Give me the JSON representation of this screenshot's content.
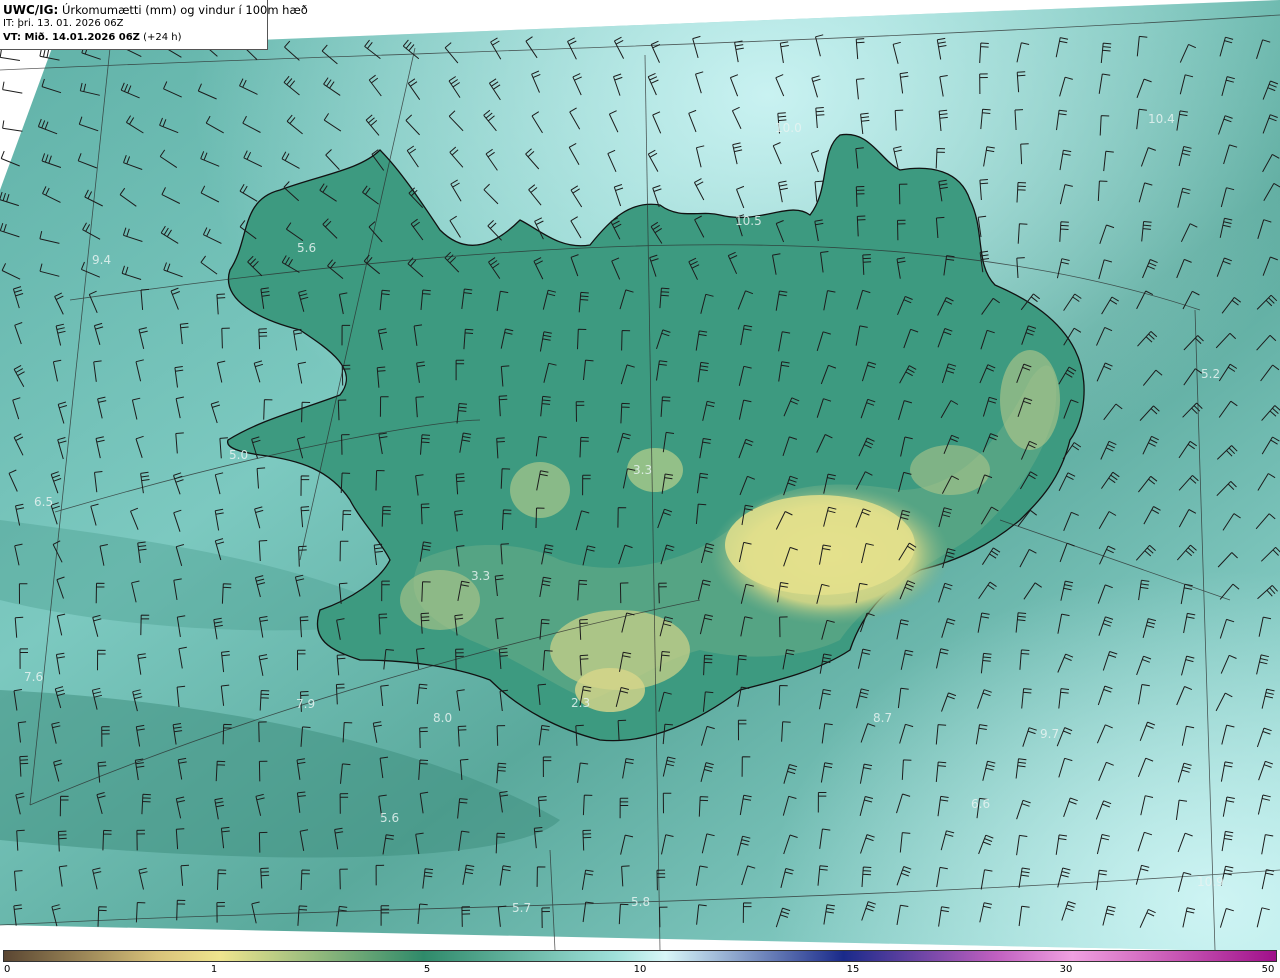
{
  "header": {
    "product": "UWC/IG:",
    "description": "Úrkomumætti (mm) og vindur í 100m hæð",
    "issue_time": "IT: þri. 13. 01. 2026 06Z",
    "valid_time_label": "VT: Mið. 14.01.2026 06Z",
    "lead_time": "(+24 h)"
  },
  "colorbar": {
    "ticks": [
      "0",
      "1",
      "5",
      "10",
      "15",
      "30",
      "50"
    ],
    "colors": [
      "#5a4632",
      "#d8c27a",
      "#efe58e",
      "#2f8a6a",
      "#9fe0da",
      "#d8f6f8",
      "#1a2a8a",
      "#c060c0",
      "#f0a0e0",
      "#a0108a"
    ]
  },
  "map": {
    "sea_color": "#6ec2b8",
    "land_low_color": "#3a9a7e",
    "land_high_color": "#d6d58a",
    "coast_color": "#1a1a1a",
    "labels": [
      "9.4",
      "5.6",
      "10.0",
      "10.5",
      "10.4",
      "5.2",
      "5.0",
      "6.5",
      "3.3",
      "3.3",
      "2.3",
      "7.6",
      "7.9",
      "8.0",
      "5.6",
      "6.6",
      "5.7",
      "5.8",
      "10.9",
      "9.7",
      "8.7"
    ]
  }
}
